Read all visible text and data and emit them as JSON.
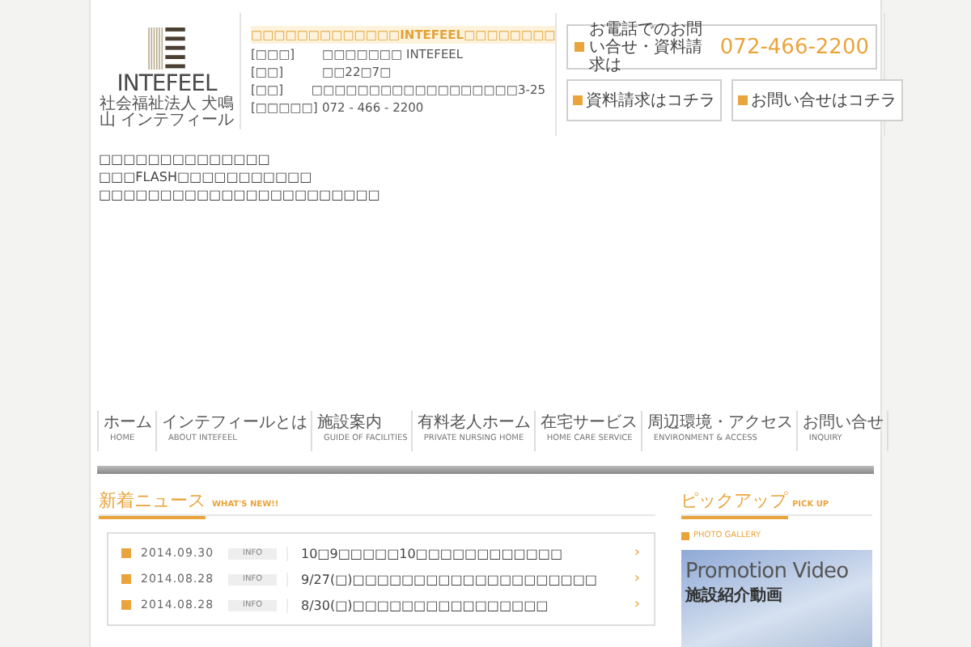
{
  "logo": {
    "wordmark": "INTEFEEL",
    "subtitle": "社会福祉法人 犬鳴山 インテフィール"
  },
  "info": {
    "headline": "□□□□□□□□□□□□□INTEFEEL□□□□□□□□",
    "rows": [
      {
        "label": "[□□□]",
        "value": "□□□□□□□ INTEFEEL"
      },
      {
        "label": "[□□]",
        "value": "□□22□7□"
      },
      {
        "label": "[□□]",
        "value": "□□□□□□□□□□□□□□□□□□3-25"
      },
      {
        "label": "[□□□□□]",
        "value": "072 - 466 - 2200"
      }
    ]
  },
  "contact": {
    "phone_label": "お電話でのお問い合せ・資料請求は",
    "phone": "072-466-2200",
    "buttons": [
      "資料請求はコチラ",
      "お問い合せはコチラ"
    ]
  },
  "intro": [
    "□□□□□□□□□□□□□□",
    "□□□FLASH□□□□□□□□□□□",
    "□□□□□□□□□□□□□□□□□□□□□□□"
  ],
  "nav": [
    {
      "label": "ホーム",
      "sub": "HOME"
    },
    {
      "label": "インテフィールとは",
      "sub": "ABOUT INTEFEEL"
    },
    {
      "label": "施設案内",
      "sub": "GUIDE OF FACILITIES"
    },
    {
      "label": "有料老人ホーム",
      "sub": "PRIVATE NURSING HOME"
    },
    {
      "label": "在宅サービス",
      "sub": "HOME CARE SERVICE"
    },
    {
      "label": "周辺環境・アクセス",
      "sub": "ENVIRONMENT & ACCESS"
    },
    {
      "label": "お問い合せ",
      "sub": "INQUIRY"
    }
  ],
  "news": {
    "title": "新着ニュース",
    "subtitle": "WHAT'S NEW!!",
    "items": [
      {
        "date": "2014.09.30",
        "tag": "INFO",
        "text": "10□9□□□□□10□□□□□□□□□□□□",
        "arrow": "›"
      },
      {
        "date": "2014.08.28",
        "tag": "INFO",
        "text": "9/27(□)□□□□□□□□□□□□□□□□□□□□",
        "arrow": "›"
      },
      {
        "date": "2014.08.28",
        "tag": "INFO",
        "text": "8/30(□)□□□□□□□□□□□□□□□□",
        "arrow": "›"
      }
    ]
  },
  "pickup": {
    "title": "ピックアップ",
    "subtitle": "PICK UP",
    "section": "PHOTO GALLERY",
    "banner_title": "Promotion Video",
    "banner_subtitle": "施設紹介動画"
  }
}
